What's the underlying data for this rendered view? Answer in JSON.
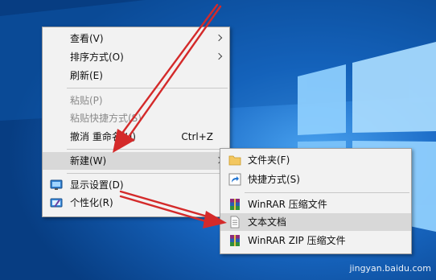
{
  "context_menu": {
    "items": [
      {
        "label": "查看(V)"
      },
      {
        "label": "排序方式(O)"
      },
      {
        "label": "刷新(E)"
      },
      {
        "label": "粘贴(P)"
      },
      {
        "label": "粘贴快捷方式(S)"
      },
      {
        "label": "撤消 重命名(U)",
        "shortcut": "Ctrl+Z"
      },
      {
        "label": "新建(W)"
      },
      {
        "label": "显示设置(D)"
      },
      {
        "label": "个性化(R)"
      }
    ]
  },
  "new_submenu": {
    "items": [
      {
        "label": "文件夹(F)",
        "icon": "folder-icon"
      },
      {
        "label": "快捷方式(S)",
        "icon": "shortcut-icon"
      },
      {
        "label": "WinRAR 压缩文件",
        "icon": "winrar-archive-icon"
      },
      {
        "label": "文本文档",
        "icon": "text-document-icon"
      },
      {
        "label": "WinRAR ZIP 压缩文件",
        "icon": "winrar-zip-icon"
      }
    ]
  },
  "watermark": {
    "text": "jingyan.baidu.com"
  },
  "colors": {
    "desktop": "#0b4f9c",
    "menu_bg": "#f2f2f2",
    "highlight": "#d8d8d8",
    "annotation_arrow": "#d42a2a"
  }
}
